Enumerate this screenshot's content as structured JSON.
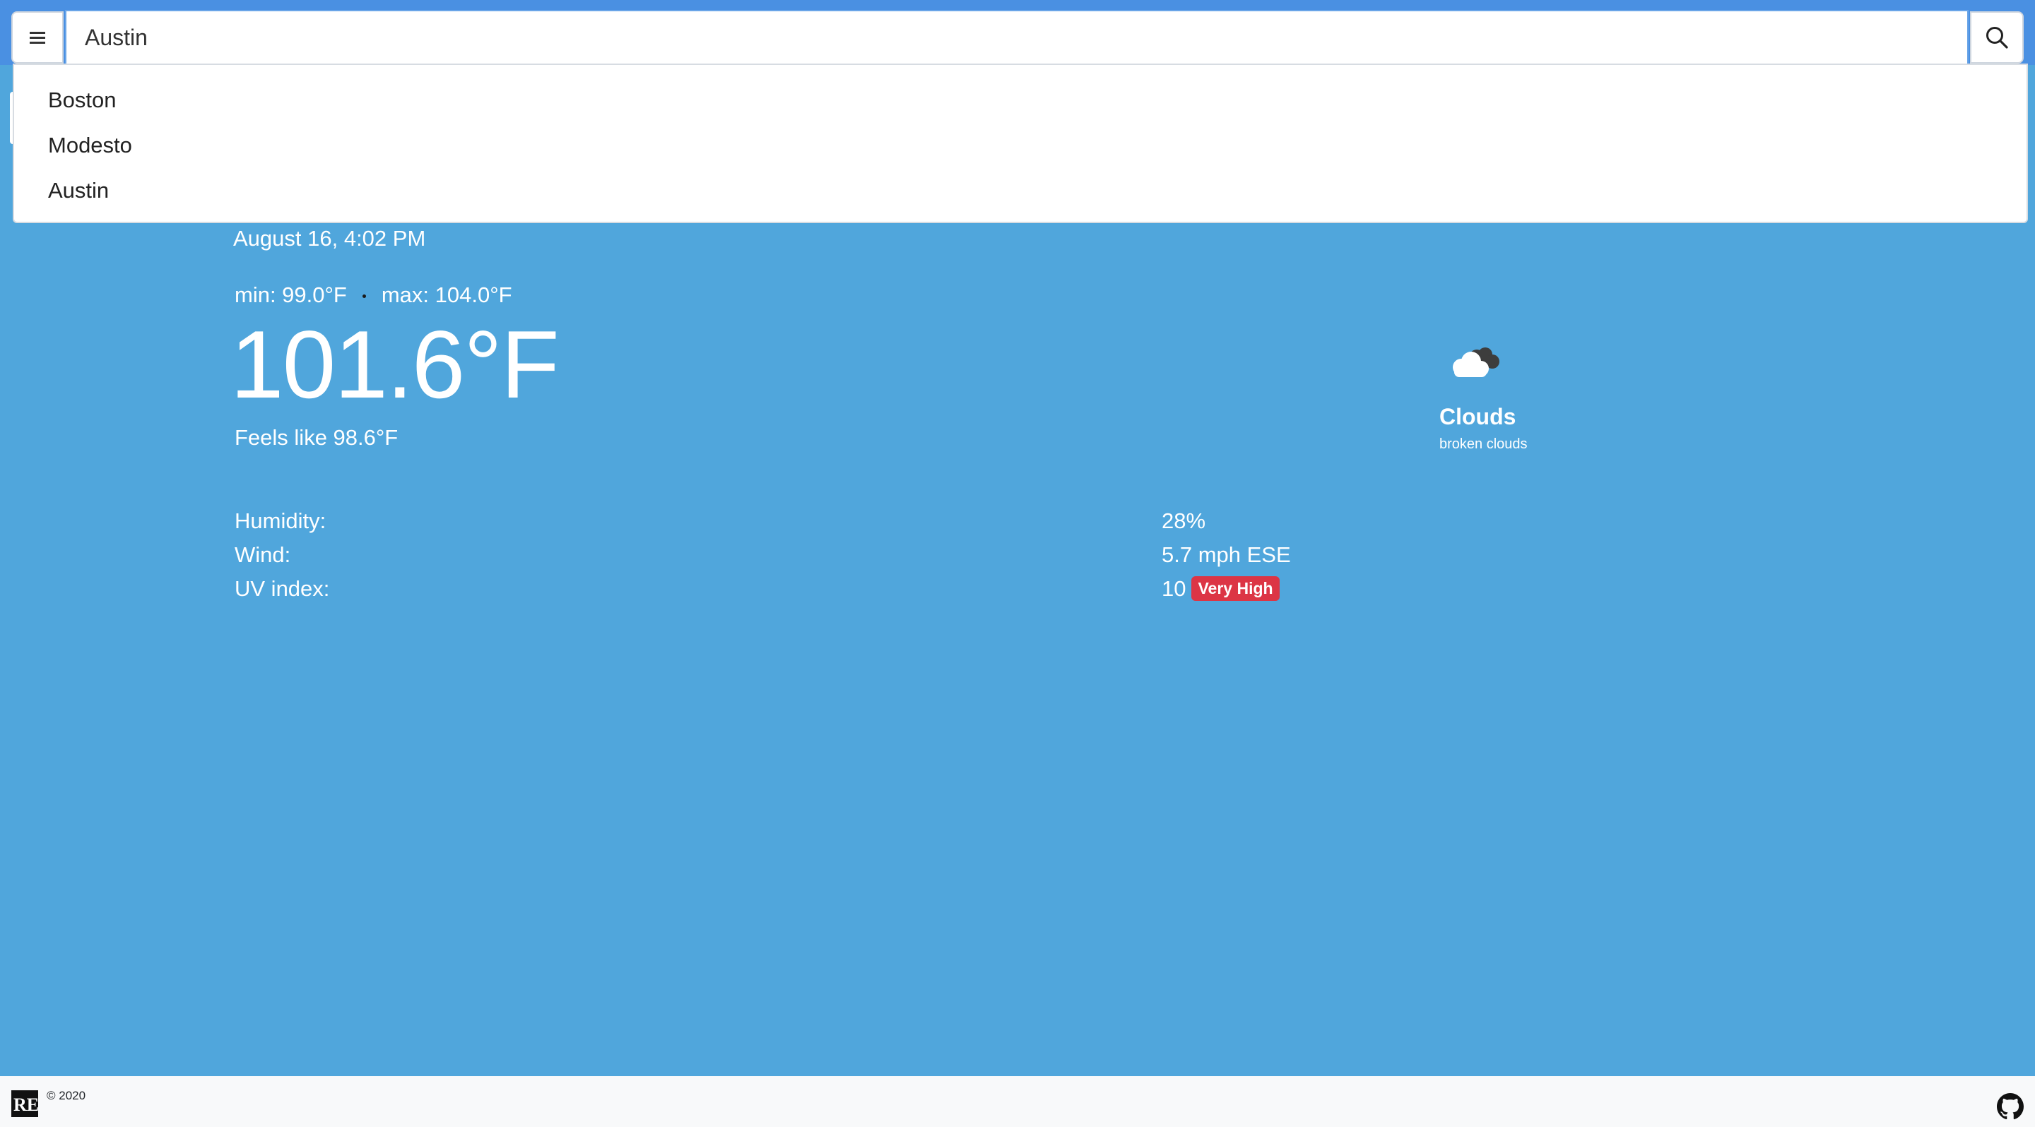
{
  "search": {
    "value": "Austin",
    "menu_icon": "hamburger-menu-icon",
    "search_icon": "magnifier-icon"
  },
  "dropdown": {
    "items": [
      "Boston",
      "Modesto",
      "Austin"
    ]
  },
  "weather": {
    "date": "August 16, 4:02 PM",
    "min": "min: 99.0°F",
    "max": "max: 104.0°F",
    "temperature": "101.6°F",
    "feels_like": "Feels like 98.6°F",
    "condition": "Clouds",
    "description": "broken clouds",
    "icon": "broken-clouds-icon"
  },
  "details": {
    "humidity_label": "Humidity:",
    "humidity_value": "28%",
    "wind_label": "Wind:",
    "wind_value": "5.7 mph ESE",
    "uv_label": "UV index:",
    "uv_value": "10",
    "uv_badge": "Very High"
  },
  "footer": {
    "logo_text": "RE",
    "copyright": "© 2020",
    "github_icon": "github-icon"
  },
  "colors": {
    "background": "#50a6dc",
    "topbar": "#4a90e2",
    "badge": "#dc3545",
    "footer": "#f8f9fa"
  }
}
